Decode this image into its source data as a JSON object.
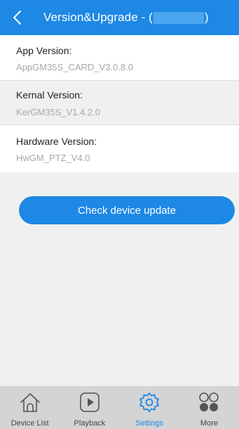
{
  "header": {
    "title": "Version&Upgrade - (",
    "title_suffix": ")"
  },
  "sections": [
    {
      "label": "App Version:",
      "value": "AppGM35S_CARD_V3.0.8.0"
    },
    {
      "label": "Kernal Version:",
      "value": "KerGM35S_V1.4.2.0"
    },
    {
      "label": "Hardware Version:",
      "value": "HwGM_PTZ_V4.0"
    }
  ],
  "update_button": {
    "label": "Check device update"
  },
  "tabbar": {
    "items": [
      {
        "label": "Device List",
        "icon": "home-icon"
      },
      {
        "label": "Playback",
        "icon": "play-icon"
      },
      {
        "label": "Settings",
        "icon": "gear-icon",
        "active": true
      },
      {
        "label": "More",
        "icon": "more-icon"
      }
    ]
  },
  "colors": {
    "accent": "#1e88e5",
    "background": "#f0f0f0",
    "tabbar": "#d4d4d4"
  }
}
